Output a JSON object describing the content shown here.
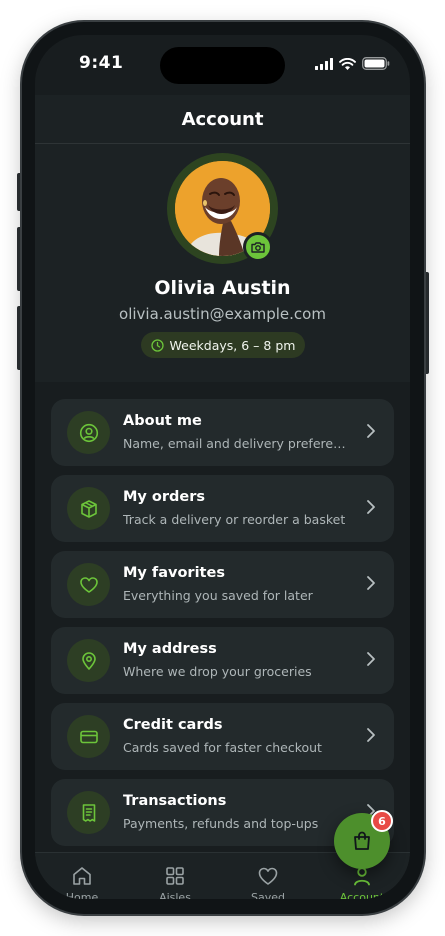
{
  "status_bar": {
    "time": "9:41"
  },
  "header": {
    "title": "Account"
  },
  "profile": {
    "name": "Olivia Austin",
    "email": "olivia.austin@example.com",
    "availability": "Weekdays, 6 – 8 pm"
  },
  "menu": [
    {
      "title": "About me",
      "subtitle": "Name, email and delivery preferences",
      "icon": "user-circle-icon"
    },
    {
      "title": "My orders",
      "subtitle": "Track a delivery or reorder a basket",
      "icon": "box-icon"
    },
    {
      "title": "My favorites",
      "subtitle": "Everything you saved for later",
      "icon": "heart-icon"
    },
    {
      "title": "My address",
      "subtitle": "Where we drop your groceries",
      "icon": "map-pin-icon"
    },
    {
      "title": "Credit cards",
      "subtitle": "Cards saved for faster checkout",
      "icon": "credit-card-icon"
    },
    {
      "title": "Transactions",
      "subtitle": "Payments, refunds and top-ups",
      "icon": "receipt-icon"
    }
  ],
  "bottom_nav": [
    {
      "label": "Home",
      "icon": "home-icon"
    },
    {
      "label": "Aisles",
      "icon": "grid-icon"
    },
    {
      "label": "Saved",
      "icon": "heart-icon"
    },
    {
      "label": "Account",
      "icon": "user-icon",
      "active": true
    }
  ],
  "cart": {
    "count": "6"
  },
  "colors": {
    "accent": "#6cc43a",
    "background": "#181d1f",
    "card": "#232a2c",
    "badge": "#e84a45"
  }
}
